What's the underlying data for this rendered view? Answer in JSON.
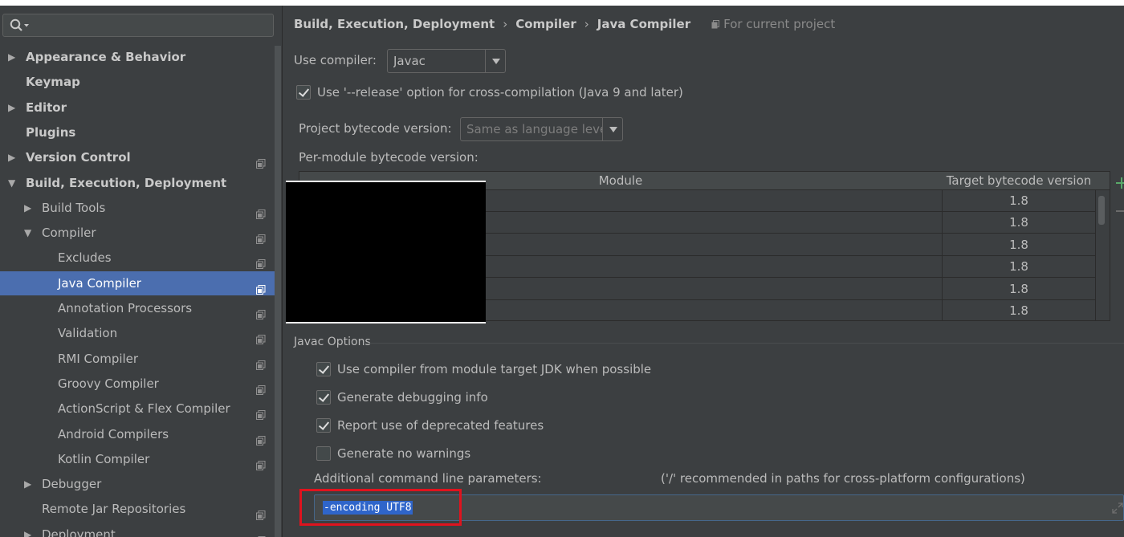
{
  "sidebar": {
    "search_placeholder": "",
    "items": [
      {
        "label": "Appearance & Behavior",
        "bold": true,
        "arrow": "right",
        "level": 0,
        "project_icon": false
      },
      {
        "label": "Keymap",
        "bold": true,
        "arrow": "",
        "level": 0,
        "project_icon": false
      },
      {
        "label": "Editor",
        "bold": true,
        "arrow": "right",
        "level": 0,
        "project_icon": false
      },
      {
        "label": "Plugins",
        "bold": true,
        "arrow": "",
        "level": 0,
        "project_icon": false
      },
      {
        "label": "Version Control",
        "bold": true,
        "arrow": "right",
        "level": 0,
        "project_icon": true
      },
      {
        "label": "Build, Execution, Deployment",
        "bold": true,
        "arrow": "down",
        "level": 0,
        "project_icon": false
      },
      {
        "label": "Build Tools",
        "bold": false,
        "arrow": "right",
        "level": 1,
        "project_icon": true
      },
      {
        "label": "Compiler",
        "bold": false,
        "arrow": "down",
        "level": 1,
        "project_icon": true
      },
      {
        "label": "Excludes",
        "bold": false,
        "arrow": "",
        "level": 2,
        "project_icon": true
      },
      {
        "label": "Java Compiler",
        "bold": false,
        "arrow": "",
        "level": 2,
        "project_icon": true,
        "selected": true
      },
      {
        "label": "Annotation Processors",
        "bold": false,
        "arrow": "",
        "level": 2,
        "project_icon": true
      },
      {
        "label": "Validation",
        "bold": false,
        "arrow": "",
        "level": 2,
        "project_icon": true
      },
      {
        "label": "RMI Compiler",
        "bold": false,
        "arrow": "",
        "level": 2,
        "project_icon": true
      },
      {
        "label": "Groovy Compiler",
        "bold": false,
        "arrow": "",
        "level": 2,
        "project_icon": true
      },
      {
        "label": "ActionScript & Flex Compiler",
        "bold": false,
        "arrow": "",
        "level": 2,
        "project_icon": true
      },
      {
        "label": "Android Compilers",
        "bold": false,
        "arrow": "",
        "level": 2,
        "project_icon": true
      },
      {
        "label": "Kotlin Compiler",
        "bold": false,
        "arrow": "",
        "level": 2,
        "project_icon": true
      },
      {
        "label": "Debugger",
        "bold": false,
        "arrow": "right",
        "level": 1,
        "project_icon": false
      },
      {
        "label": "Remote Jar Repositories",
        "bold": false,
        "arrow": "",
        "level": 1,
        "project_icon": true
      },
      {
        "label": "Deployment",
        "bold": false,
        "arrow": "right",
        "level": 1,
        "project_icon": true
      }
    ]
  },
  "breadcrumb": {
    "part1": "Build, Execution, Deployment",
    "sep": "›",
    "part2": "Compiler",
    "part3": "Java Compiler",
    "scope": "For current project"
  },
  "compiler": {
    "use_label": "Use compiler:",
    "value": "Javac"
  },
  "release_option": {
    "label": "Use '--release' option for cross-compilation (Java 9 and later)",
    "checked": true
  },
  "bytecode": {
    "project_label": "Project bytecode version:",
    "project_value": "Same as language leve",
    "per_module_label": "Per-module bytecode version:"
  },
  "table": {
    "col_module": "Module",
    "col_target": "Target bytecode version",
    "rows": [
      "1.8",
      "1.8",
      "1.8",
      "1.8",
      "1.8",
      "1.8"
    ]
  },
  "javac": {
    "section_title": "Javac Options",
    "options": [
      {
        "label": "Use compiler from module target JDK when possible",
        "checked": true
      },
      {
        "label": "Generate debugging info",
        "checked": true
      },
      {
        "label": "Report use of deprecated features",
        "checked": true
      },
      {
        "label": "Generate no warnings",
        "checked": false
      }
    ],
    "params_label": "Additional command line parameters:",
    "params_hint": "('/' recommended in paths for cross-platform configurations)",
    "params_value": "-encoding UTF8"
  },
  "colors": {
    "background": "#3c3f41",
    "selection": "#4b6eaf",
    "highlight_box": "#e0131e",
    "add_green": "#59a869"
  }
}
